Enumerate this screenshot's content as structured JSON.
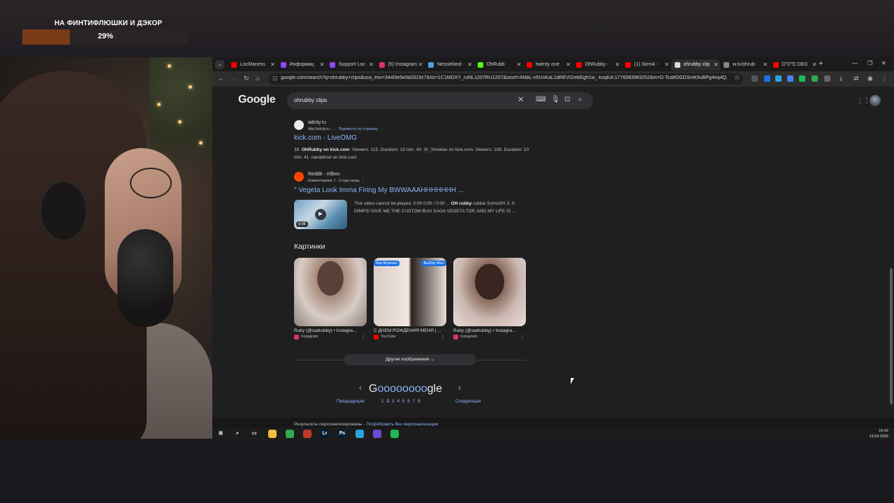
{
  "overlay": {
    "goal_title": "НА ФИНТИФЛЮШКИ И ДЭКОР",
    "goal_percent_label": "29%",
    "goal_progress": 0.29,
    "goal_color": "#7a3b18"
  },
  "tabs": [
    {
      "label": "LocManess",
      "icon": "youtube-icon",
      "color": "#ff0000"
    },
    {
      "label": "Информац",
      "icon": "purple-icon",
      "color": "#9146ff"
    },
    {
      "label": "Support Loc",
      "icon": "twitch-icon",
      "color": "#9146ff"
    },
    {
      "label": "(5) Instagram",
      "icon": "instagram-icon",
      "color": "#e1306c"
    },
    {
      "label": "Nessieland",
      "icon": "globe-icon",
      "color": "#4aa3df"
    },
    {
      "label": "OhRubb",
      "icon": "kick-icon",
      "color": "#53fc18"
    },
    {
      "label": "twenty one",
      "icon": "youtube-icon",
      "color": "#ff0000"
    },
    {
      "label": "OhRubby -",
      "icon": "youtube-icon",
      "color": "#ff0000"
    },
    {
      "label": "(1) Sims4 -",
      "icon": "youtube-icon",
      "color": "#ff0000"
    },
    {
      "label": "ohrubby clip",
      "icon": "google-icon",
      "color": "#dadce0",
      "active": true
    },
    {
      "label": "w.tv/ohrub",
      "icon": "page-icon",
      "color": "#888888"
    },
    {
      "label": "D\"D\"D DED",
      "icon": "youtube-icon",
      "color": "#ff0000"
    }
  ],
  "toolbar": {
    "url": "google.com/search?q=ohrubby+clips&sca_esv=344f3e5e0d3315c7&rlz=1C1MDXY_ruNL1207RU1207&sxsrf=ANbL-n5UnKaL1dREVl2rekEgh1w_-ksqKA:1776083983252&ei=D-TcaflOGDSmK9uBPg4eq4Q..."
  },
  "search": {
    "logo": "Google",
    "query": "ohrubby clips"
  },
  "results": [
    {
      "site": "adcity.ru",
      "url": "http://adcity.ru › ...",
      "translate": "Перевести эту страницу",
      "title": "kick.com - LiveOMG",
      "snippet_parts": [
        "39. ",
        "OhRubby on kick.com",
        ". Viewers: 115. Duration: 10 min. 40. Sr_Smokee on kick.com. Viewers: 108. Duration: 10 min. 41. nanabhsd on kick.com"
      ]
    },
    {
      "site": "Reddit · r/dbxv",
      "url": "Комментариев: 7 · 2 года назад",
      "title": "\" Vegeta Look Imma Firing My BWWAAAHHHHHHH ...",
      "snippet_parts": [
        "This video cannot be played. 0:00 0:00 / 0:00 ... ",
        "OH rubby",
        " rubbie SoHoOh! 3. 0. DIMPS! GIVE ME THE CUSTOM BUU SAGA VEGETA TOP, AND MY LIFE IS ..."
      ],
      "video_duration": "0:08"
    }
  ],
  "images": {
    "heading": "Картинки",
    "items": [
      {
        "caption": "Ruby (@sadrubby) • Instagra...",
        "source": "Instagram",
        "source_color": "#e1306c"
      },
      {
        "caption": "С ДНЕМ РОЖДЕНИЯ МЕНЯ | ...",
        "source": "YouTube",
        "source_color": "#ff0000",
        "tags": [
          "бор Мужчин",
          "Выбор Жен"
        ]
      },
      {
        "caption": "Ruby (@sadrubby) • Instagra...",
        "source": "Instagram",
        "source_color": "#e1306c"
      }
    ],
    "more_label": "Другие изображения"
  },
  "pager": {
    "logo_prefix": "G",
    "logo_os": "oooooooo",
    "logo_suffix": "gle",
    "prev": "Предыдущая",
    "next": "Следующая",
    "numbers": [
      "1",
      "2",
      "3",
      "4",
      "5",
      "6",
      "7",
      "8"
    ],
    "current": "2"
  },
  "footer": {
    "text": "Результаты персонализированы - ",
    "link": "Попробовать без персонализации"
  },
  "taskbar": {
    "time": "15:42",
    "date": "13.04.2026",
    "apps": [
      {
        "name": "windows-start-icon",
        "glyph": "⊞",
        "color": "transparent"
      },
      {
        "name": "search-icon",
        "glyph": "⌕",
        "color": "transparent"
      },
      {
        "name": "task-view-icon",
        "glyph": "▭",
        "color": "transparent"
      },
      {
        "name": "file-explorer-icon",
        "glyph": "",
        "color": "#f0c040"
      },
      {
        "name": "chrome-icon",
        "glyph": "",
        "color": "#34a853"
      },
      {
        "name": "app-red-icon",
        "glyph": "",
        "color": "#c0392b"
      },
      {
        "name": "lightroom-icon",
        "glyph": "Lr",
        "color": "#001e36"
      },
      {
        "name": "photoshop-icon",
        "glyph": "Ps",
        "color": "#001e36"
      },
      {
        "name": "telegram-icon",
        "glyph": "",
        "color": "#2aa3dd"
      },
      {
        "name": "app-purple-icon",
        "glyph": "",
        "color": "#6c4ad6"
      },
      {
        "name": "spotify-icon",
        "glyph": "",
        "color": "#1db954"
      }
    ]
  }
}
